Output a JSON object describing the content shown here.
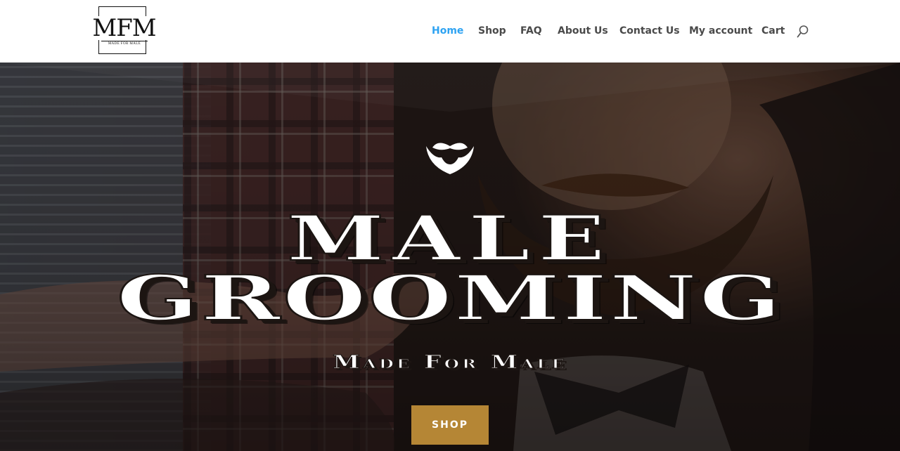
{
  "brand": {
    "logo_text": "MFM",
    "logo_subtext": "MADE FOR MALE"
  },
  "nav": {
    "items": [
      {
        "label": "Home",
        "active": true
      },
      {
        "label": "Shop",
        "active": false
      },
      {
        "label": "FAQ",
        "active": false
      },
      {
        "label": "About Us",
        "active": false
      },
      {
        "label": "Contact Us",
        "active": false
      },
      {
        "label": "My account",
        "active": false
      },
      {
        "label": "Cart",
        "active": false
      }
    ],
    "search_icon": "search-icon"
  },
  "hero": {
    "icon": "beard-mustache-icon",
    "title_line1": "Male",
    "title_line2": "Grooming",
    "subtitle": "Made For Male",
    "cta_label": "SHOP"
  },
  "colors": {
    "nav_active": "#2ea3f2",
    "nav_text": "#4a4a4a",
    "cta_background": "#b58635",
    "hero_text": "#ffffff"
  }
}
